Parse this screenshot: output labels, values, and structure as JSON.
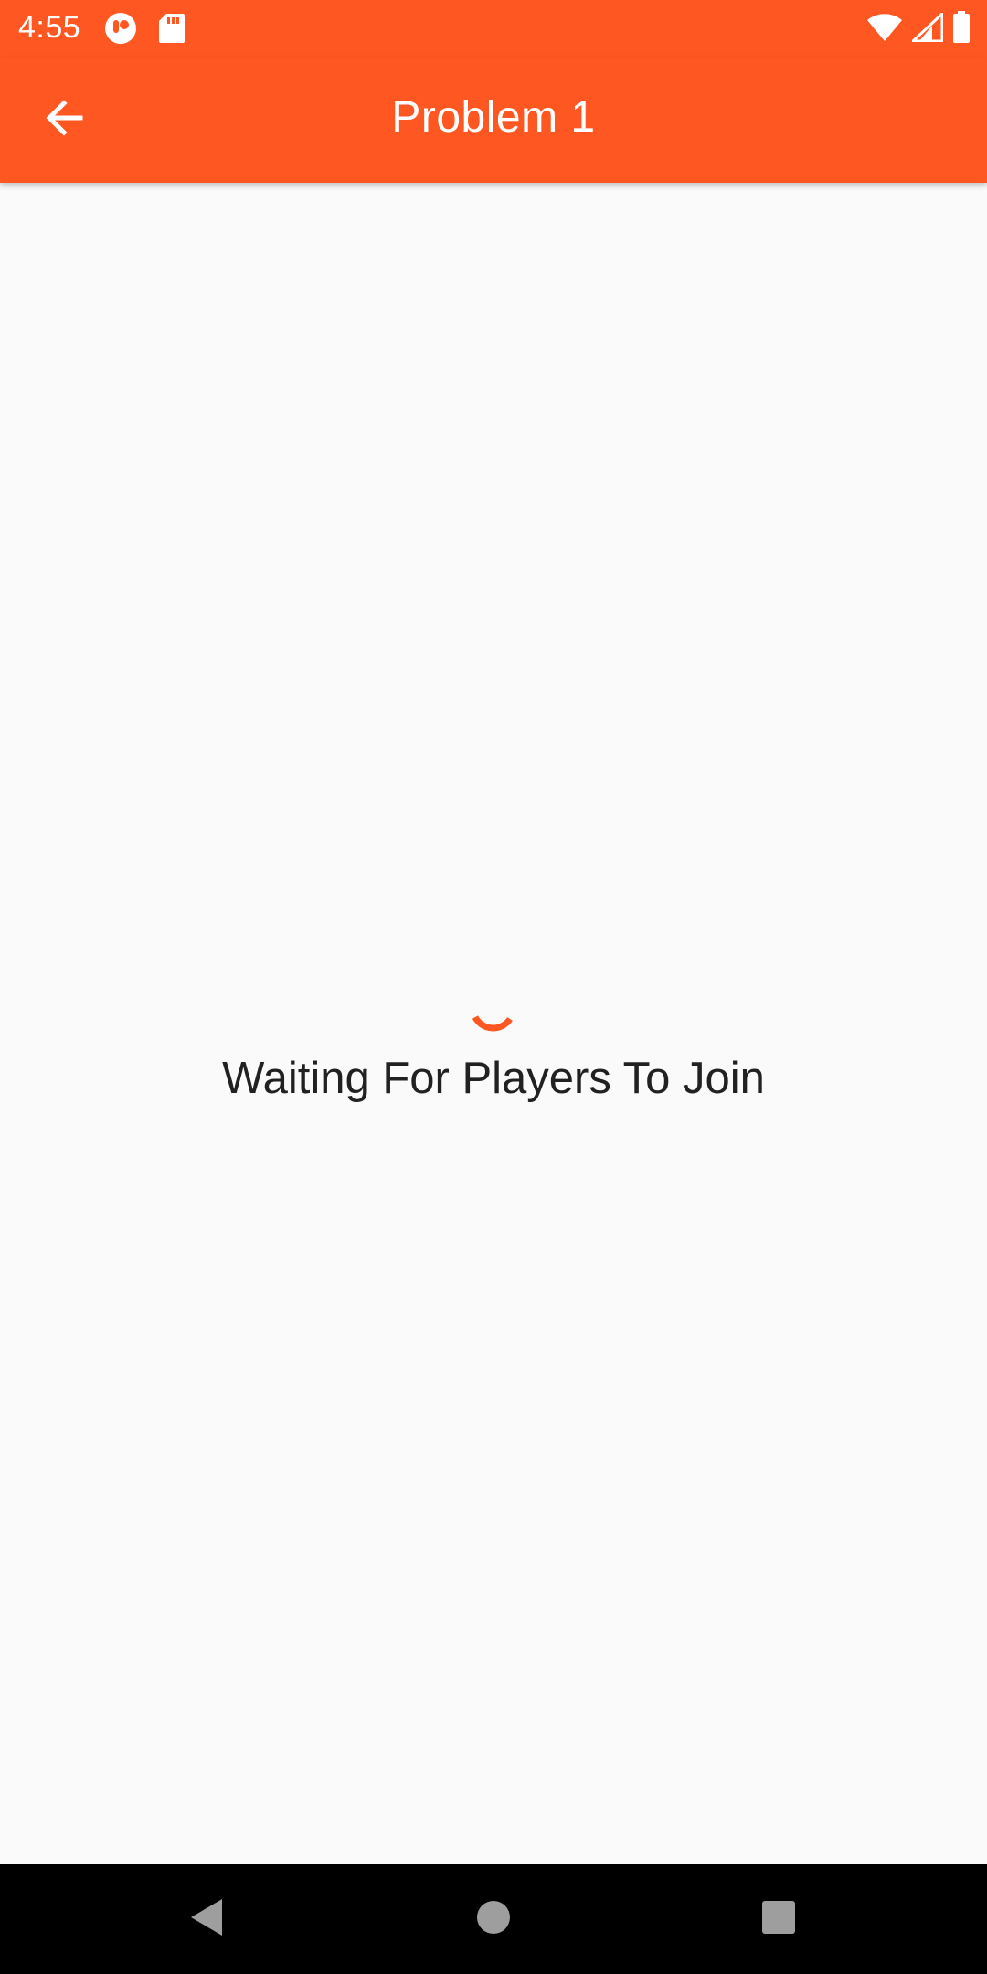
{
  "status_bar": {
    "time": "4:55",
    "notification_icons": [
      "app-notification-icon",
      "sd-card-icon"
    ],
    "system_icons": [
      "wifi-icon",
      "cell-signal-icon",
      "battery-icon"
    ]
  },
  "app_bar": {
    "title": "Problem 1",
    "back_icon": "arrow-back-icon"
  },
  "main": {
    "loading_icon": "loading-spinner",
    "waiting_text": "Waiting For Players To Join"
  },
  "nav_bar": {
    "buttons": [
      "back-triangle-icon",
      "home-circle-icon",
      "recents-square-icon"
    ]
  },
  "colors": {
    "primary": "#FF5722",
    "background": "#FAFAFA",
    "text": "#212121",
    "nav_bar": "#000000"
  }
}
